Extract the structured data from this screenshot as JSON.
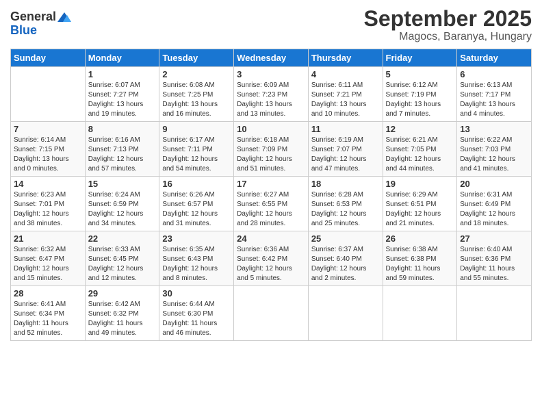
{
  "logo": {
    "general": "General",
    "blue": "Blue"
  },
  "title": "September 2025",
  "subtitle": "Magocs, Baranya, Hungary",
  "days_of_week": [
    "Sunday",
    "Monday",
    "Tuesday",
    "Wednesday",
    "Thursday",
    "Friday",
    "Saturday"
  ],
  "weeks": [
    [
      {
        "day": "",
        "info": ""
      },
      {
        "day": "1",
        "info": "Sunrise: 6:07 AM\nSunset: 7:27 PM\nDaylight: 13 hours\nand 19 minutes."
      },
      {
        "day": "2",
        "info": "Sunrise: 6:08 AM\nSunset: 7:25 PM\nDaylight: 13 hours\nand 16 minutes."
      },
      {
        "day": "3",
        "info": "Sunrise: 6:09 AM\nSunset: 7:23 PM\nDaylight: 13 hours\nand 13 minutes."
      },
      {
        "day": "4",
        "info": "Sunrise: 6:11 AM\nSunset: 7:21 PM\nDaylight: 13 hours\nand 10 minutes."
      },
      {
        "day": "5",
        "info": "Sunrise: 6:12 AM\nSunset: 7:19 PM\nDaylight: 13 hours\nand 7 minutes."
      },
      {
        "day": "6",
        "info": "Sunrise: 6:13 AM\nSunset: 7:17 PM\nDaylight: 13 hours\nand 4 minutes."
      }
    ],
    [
      {
        "day": "7",
        "info": "Sunrise: 6:14 AM\nSunset: 7:15 PM\nDaylight: 13 hours\nand 0 minutes."
      },
      {
        "day": "8",
        "info": "Sunrise: 6:16 AM\nSunset: 7:13 PM\nDaylight: 12 hours\nand 57 minutes."
      },
      {
        "day": "9",
        "info": "Sunrise: 6:17 AM\nSunset: 7:11 PM\nDaylight: 12 hours\nand 54 minutes."
      },
      {
        "day": "10",
        "info": "Sunrise: 6:18 AM\nSunset: 7:09 PM\nDaylight: 12 hours\nand 51 minutes."
      },
      {
        "day": "11",
        "info": "Sunrise: 6:19 AM\nSunset: 7:07 PM\nDaylight: 12 hours\nand 47 minutes."
      },
      {
        "day": "12",
        "info": "Sunrise: 6:21 AM\nSunset: 7:05 PM\nDaylight: 12 hours\nand 44 minutes."
      },
      {
        "day": "13",
        "info": "Sunrise: 6:22 AM\nSunset: 7:03 PM\nDaylight: 12 hours\nand 41 minutes."
      }
    ],
    [
      {
        "day": "14",
        "info": "Sunrise: 6:23 AM\nSunset: 7:01 PM\nDaylight: 12 hours\nand 38 minutes."
      },
      {
        "day": "15",
        "info": "Sunrise: 6:24 AM\nSunset: 6:59 PM\nDaylight: 12 hours\nand 34 minutes."
      },
      {
        "day": "16",
        "info": "Sunrise: 6:26 AM\nSunset: 6:57 PM\nDaylight: 12 hours\nand 31 minutes."
      },
      {
        "day": "17",
        "info": "Sunrise: 6:27 AM\nSunset: 6:55 PM\nDaylight: 12 hours\nand 28 minutes."
      },
      {
        "day": "18",
        "info": "Sunrise: 6:28 AM\nSunset: 6:53 PM\nDaylight: 12 hours\nand 25 minutes."
      },
      {
        "day": "19",
        "info": "Sunrise: 6:29 AM\nSunset: 6:51 PM\nDaylight: 12 hours\nand 21 minutes."
      },
      {
        "day": "20",
        "info": "Sunrise: 6:31 AM\nSunset: 6:49 PM\nDaylight: 12 hours\nand 18 minutes."
      }
    ],
    [
      {
        "day": "21",
        "info": "Sunrise: 6:32 AM\nSunset: 6:47 PM\nDaylight: 12 hours\nand 15 minutes."
      },
      {
        "day": "22",
        "info": "Sunrise: 6:33 AM\nSunset: 6:45 PM\nDaylight: 12 hours\nand 12 minutes."
      },
      {
        "day": "23",
        "info": "Sunrise: 6:35 AM\nSunset: 6:43 PM\nDaylight: 12 hours\nand 8 minutes."
      },
      {
        "day": "24",
        "info": "Sunrise: 6:36 AM\nSunset: 6:42 PM\nDaylight: 12 hours\nand 5 minutes."
      },
      {
        "day": "25",
        "info": "Sunrise: 6:37 AM\nSunset: 6:40 PM\nDaylight: 12 hours\nand 2 minutes."
      },
      {
        "day": "26",
        "info": "Sunrise: 6:38 AM\nSunset: 6:38 PM\nDaylight: 11 hours\nand 59 minutes."
      },
      {
        "day": "27",
        "info": "Sunrise: 6:40 AM\nSunset: 6:36 PM\nDaylight: 11 hours\nand 55 minutes."
      }
    ],
    [
      {
        "day": "28",
        "info": "Sunrise: 6:41 AM\nSunset: 6:34 PM\nDaylight: 11 hours\nand 52 minutes."
      },
      {
        "day": "29",
        "info": "Sunrise: 6:42 AM\nSunset: 6:32 PM\nDaylight: 11 hours\nand 49 minutes."
      },
      {
        "day": "30",
        "info": "Sunrise: 6:44 AM\nSunset: 6:30 PM\nDaylight: 11 hours\nand 46 minutes."
      },
      {
        "day": "",
        "info": ""
      },
      {
        "day": "",
        "info": ""
      },
      {
        "day": "",
        "info": ""
      },
      {
        "day": "",
        "info": ""
      }
    ]
  ]
}
